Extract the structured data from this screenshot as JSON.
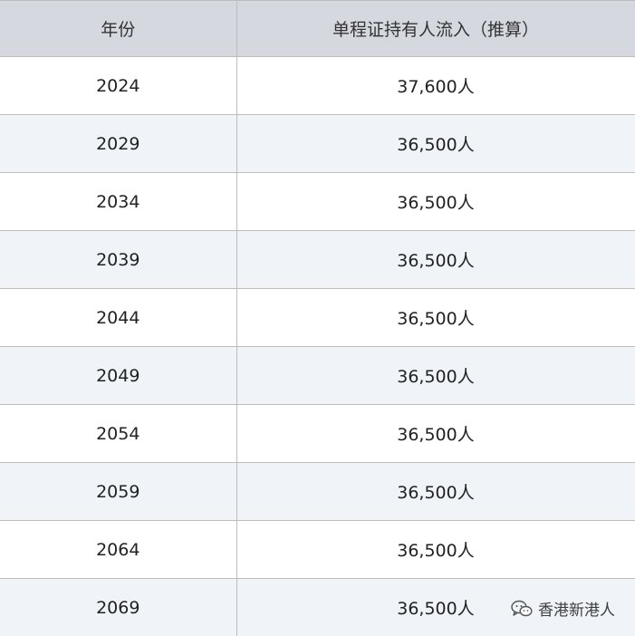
{
  "table": {
    "headers": [
      "年份",
      "单程证持有人流入（推算）"
    ],
    "rows": [
      [
        "2024",
        "37,600人"
      ],
      [
        "2029",
        "36,500人"
      ],
      [
        "2034",
        "36,500人"
      ],
      [
        "2039",
        "36,500人"
      ],
      [
        "2044",
        "36,500人"
      ],
      [
        "2049",
        "36,500人"
      ],
      [
        "2054",
        "36,500人"
      ],
      [
        "2059",
        "36,500人"
      ],
      [
        "2064",
        "36,500人"
      ],
      [
        "2069",
        "36,500人"
      ]
    ]
  },
  "watermark": {
    "text": "香港新港人",
    "icon": "wechat-icon"
  }
}
